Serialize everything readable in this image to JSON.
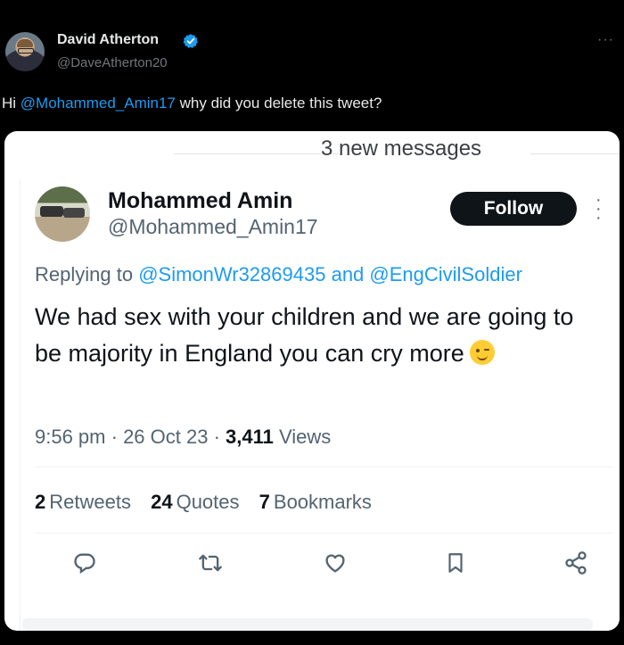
{
  "post": {
    "author_name": "David Atherton",
    "author_handle": "@DaveAtherton20",
    "text_prefix": "Hi ",
    "mention": "@Mohammed_Amin17",
    "text_suffix": " why did you delete this tweet?",
    "more_label": "···"
  },
  "embedded": {
    "banner": "3 new messages",
    "author_name": "Mohammed Amin",
    "author_handle": "@Mohammed_Amin17",
    "follow_label": "Follow",
    "replying_prefix": "Replying to ",
    "reply_to_1": "@SimonWr32869435",
    "reply_and": " and ",
    "reply_to_2": "@EngCivilSoldier",
    "body_text": "We had sex with your children and we are going to be majority in England you can cry more",
    "time": "9:56 pm",
    "date": "26 Oct 23",
    "views_count": "3,411",
    "views_label": "Views",
    "retweets_count": "2",
    "retweets_label": "Retweets",
    "quotes_count": "24",
    "quotes_label": "Quotes",
    "bookmarks_count": "7",
    "bookmarks_label": "Bookmarks",
    "sep": " · "
  },
  "icons": {
    "verified": "verified-badge-icon",
    "reply": "reply-icon",
    "retweet": "retweet-icon",
    "like": "like-icon",
    "bookmark": "bookmark-icon",
    "share": "share-icon",
    "emoji": "winking-face-emoji"
  },
  "colors": {
    "accent": "#1d9bf0",
    "background": "#000000",
    "card": "#ffffff"
  }
}
